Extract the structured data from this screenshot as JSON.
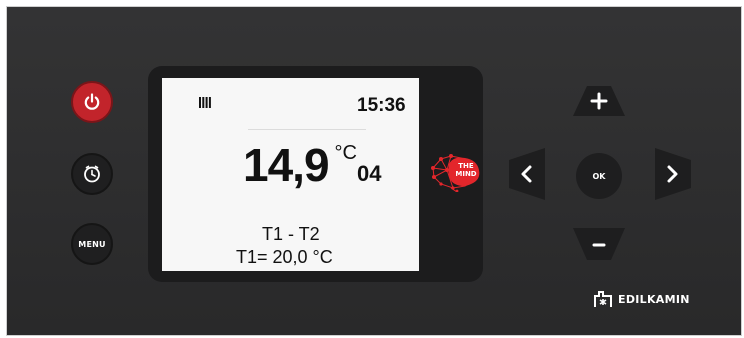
{
  "display": {
    "mode_icon": "radiator-icon",
    "time": "15:36",
    "temperature": "14,9",
    "temperature_unit": "°C",
    "power_level": "04",
    "line1": "T1 - T2",
    "line2": "T1= 20,0 °C"
  },
  "buttons": {
    "power_icon": "power-icon",
    "clock_icon": "clock-icon",
    "menu_label": "MENU",
    "up_label": "+",
    "down_label": "-",
    "left_label": "<",
    "right_label": ">",
    "ok_label": "OK"
  },
  "logo": {
    "mind_line1": "THE",
    "mind_line2": "MIND"
  },
  "brand": {
    "name": "EDILKAMIN"
  },
  "colors": {
    "panel": "#2b2b2c",
    "power_button": "#c2242b",
    "screen": "#f7f7f7",
    "mind_logo": "#e3262b"
  }
}
